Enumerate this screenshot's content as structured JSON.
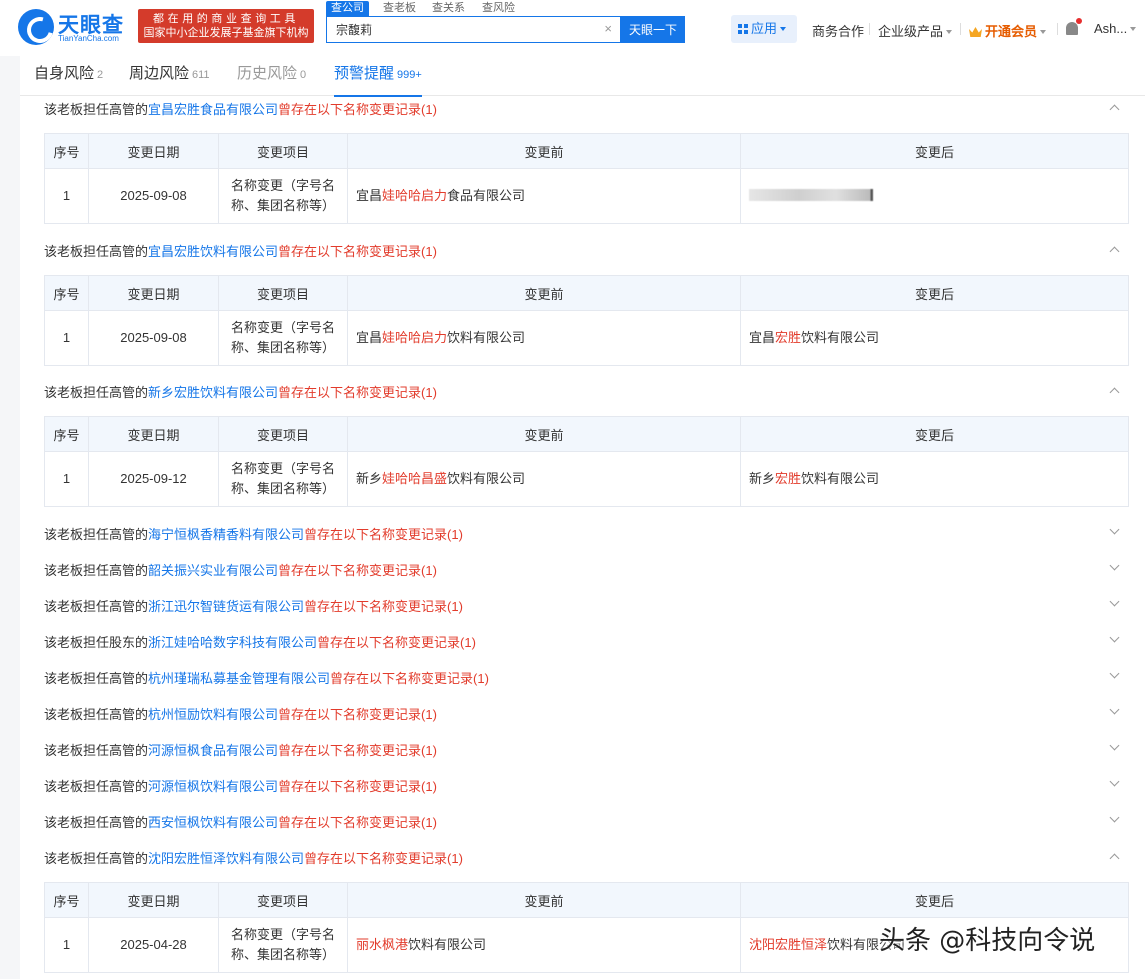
{
  "header": {
    "logo_cn": "天眼查",
    "logo_en": "TianYanCha.com",
    "slogan_line1": "都在用的商业查询工具",
    "slogan_line2": "国家中小企业发展子基金旗下机构",
    "search_tabs": [
      "查公司",
      "查老板",
      "查关系",
      "查风险"
    ],
    "search_value": "宗馥莉",
    "search_clear": "×",
    "search_button": "天眼一下",
    "apps": "应用",
    "business": "商务合作",
    "enterprise": "企业级产品",
    "vip": "开通会员",
    "user": "Ash..."
  },
  "tabs": [
    {
      "label": "自身风险",
      "count": "2"
    },
    {
      "label": "周边风险",
      "count": "611"
    },
    {
      "label": "历史风险",
      "count": "0"
    },
    {
      "label": "预警提醒",
      "count": "999+"
    }
  ],
  "table_headers": [
    "序号",
    "变更日期",
    "变更项目",
    "变更前",
    "变更后"
  ],
  "sections": [
    {
      "prefix": "该老板担任高管的",
      "company": "宜昌宏胜食品有限公司",
      "suffix": "曾存在以下名称变更记录",
      "count": "(1)",
      "expanded": true,
      "row": {
        "no": "1",
        "date": "2025-09-08",
        "item": "名称变更（字号名称、集团名称等）",
        "before": [
          "宜昌",
          "娃哈哈启力",
          "食品有限公司"
        ],
        "after": [
          "",
          "",
          ""
        ]
      }
    },
    {
      "prefix": "该老板担任高管的",
      "company": "宜昌宏胜饮料有限公司",
      "suffix": "曾存在以下名称变更记录",
      "count": "(1)",
      "expanded": true,
      "row": {
        "no": "1",
        "date": "2025-09-08",
        "item": "名称变更（字号名称、集团名称等）",
        "before": [
          "宜昌",
          "娃哈哈启力",
          "饮料有限公司"
        ],
        "after": [
          "宜昌",
          "宏胜",
          "饮料有限公司"
        ]
      }
    },
    {
      "prefix": "该老板担任高管的",
      "company": "新乡宏胜饮料有限公司",
      "suffix": "曾存在以下名称变更记录",
      "count": "(1)",
      "expanded": true,
      "row": {
        "no": "1",
        "date": "2025-09-12",
        "item": "名称变更（字号名称、集团名称等）",
        "before": [
          "新乡",
          "娃哈哈昌盛",
          "饮料有限公司"
        ],
        "after": [
          "新乡",
          "宏胜",
          "饮料有限公司"
        ]
      }
    },
    {
      "prefix": "该老板担任高管的",
      "company": "海宁恒枫香精香料有限公司",
      "suffix": "曾存在以下名称变更记录",
      "count": "(1)",
      "expanded": false
    },
    {
      "prefix": "该老板担任高管的",
      "company": "韶关振兴实业有限公司",
      "suffix": "曾存在以下名称变更记录",
      "count": "(1)",
      "expanded": false
    },
    {
      "prefix": "该老板担任高管的",
      "company": "浙江迅尔智链货运有限公司",
      "suffix": "曾存在以下名称变更记录",
      "count": "(1)",
      "expanded": false
    },
    {
      "prefix": "该老板担任股东的",
      "company": "浙江娃哈哈数字科技有限公司",
      "suffix": "曾存在以下名称变更记录",
      "count": "(1)",
      "expanded": false
    },
    {
      "prefix": "该老板担任高管的",
      "company": "杭州瑾瑞私募基金管理有限公司",
      "suffix": "曾存在以下名称变更记录",
      "count": "(1)",
      "expanded": false
    },
    {
      "prefix": "该老板担任高管的",
      "company": "杭州恒励饮料有限公司",
      "suffix": "曾存在以下名称变更记录",
      "count": "(1)",
      "expanded": false
    },
    {
      "prefix": "该老板担任高管的",
      "company": "河源恒枫食品有限公司",
      "suffix": "曾存在以下名称变更记录",
      "count": "(1)",
      "expanded": false
    },
    {
      "prefix": "该老板担任高管的",
      "company": "河源恒枫饮料有限公司",
      "suffix": "曾存在以下名称变更记录",
      "count": "(1)",
      "expanded": false
    },
    {
      "prefix": "该老板担任高管的",
      "company": "西安恒枫饮料有限公司",
      "suffix": "曾存在以下名称变更记录",
      "count": "(1)",
      "expanded": false
    },
    {
      "prefix": "该老板担任高管的",
      "company": "沈阳宏胜恒泽饮料有限公司",
      "suffix": "曾存在以下名称变更记录",
      "count": "(1)",
      "expanded": true,
      "row": {
        "no": "1",
        "date": "2025-04-28",
        "item": "名称变更（字号名称、集团名称等）",
        "before": [
          "",
          "丽水枫港",
          "饮料有限公司"
        ],
        "after": [
          "",
          "沈阳宏胜恒泽",
          "饮料有限公司"
        ]
      }
    }
  ],
  "watermark": "头条 @科技向令说"
}
